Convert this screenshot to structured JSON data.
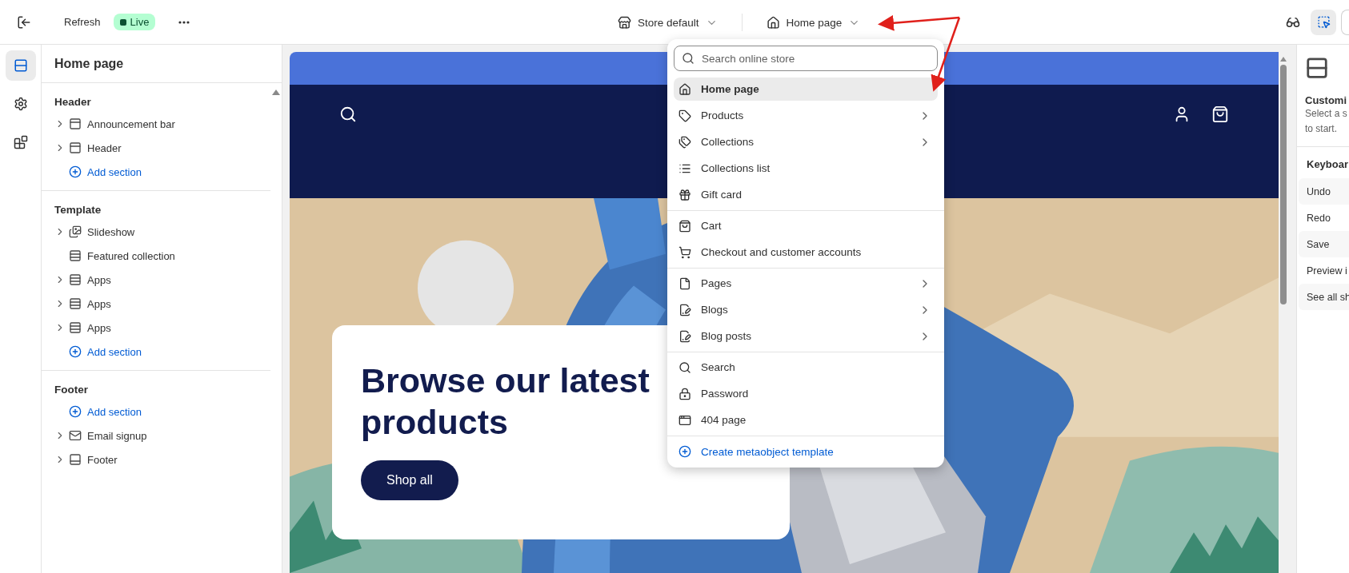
{
  "top_bar": {
    "refresh": "Refresh",
    "status": {
      "label": "Live",
      "live": true
    },
    "theme_selector": {
      "label": "Store default"
    },
    "page_selector": {
      "label": "Home page",
      "expanded": true
    },
    "inspector_selected": true
  },
  "rail": [
    {
      "kind": "sections",
      "selected": true
    },
    {
      "kind": "settings",
      "selected": false
    },
    {
      "kind": "apps",
      "selected": false
    }
  ],
  "sidebar": {
    "title": "Home page",
    "groups": [
      {
        "title": "Header",
        "items": [
          {
            "kind": "bar",
            "label": "Announcement bar",
            "expandable": true
          },
          {
            "kind": "bar",
            "label": "Header",
            "expandable": true
          },
          {
            "kind": "add",
            "label": "Add section",
            "expandable": false
          }
        ]
      },
      {
        "title": "Template",
        "items": [
          {
            "kind": "slideshow",
            "label": "Slideshow",
            "expandable": true
          },
          {
            "kind": "rows",
            "label": "Featured collection",
            "expandable": false
          },
          {
            "kind": "rows",
            "label": "Apps",
            "expandable": true
          },
          {
            "kind": "rows",
            "label": "Apps",
            "expandable": true
          },
          {
            "kind": "rows",
            "label": "Apps",
            "expandable": true
          },
          {
            "kind": "add",
            "label": "Add section",
            "expandable": false
          }
        ]
      },
      {
        "title": "Footer",
        "items": [
          {
            "kind": "add",
            "label": "Add section",
            "expandable": false
          },
          {
            "kind": "mail",
            "label": "Email signup",
            "expandable": true
          },
          {
            "kind": "footer",
            "label": "Footer",
            "expandable": true
          }
        ]
      }
    ]
  },
  "page_menu": {
    "search": {
      "placeholder": "Search online store"
    },
    "groups": [
      [
        {
          "kind": "home",
          "label": "Home page",
          "submenu": false,
          "selected": true
        },
        {
          "kind": "tag",
          "label": "Products",
          "submenu": true,
          "selected": false
        },
        {
          "kind": "tags",
          "label": "Collections",
          "submenu": true,
          "selected": false
        },
        {
          "kind": "taglist",
          "label": "Collections list",
          "submenu": false,
          "selected": false
        },
        {
          "kind": "gift",
          "label": "Gift card",
          "submenu": false,
          "selected": false
        }
      ],
      [
        {
          "kind": "bag",
          "label": "Cart",
          "submenu": false,
          "selected": false
        },
        {
          "kind": "cart",
          "label": "Checkout and customer accounts",
          "submenu": false,
          "selected": false
        }
      ],
      [
        {
          "kind": "page",
          "label": "Pages",
          "submenu": true,
          "selected": false
        },
        {
          "kind": "edit",
          "label": "Blogs",
          "submenu": true,
          "selected": false
        },
        {
          "kind": "edit",
          "label": "Blog posts",
          "submenu": true,
          "selected": false
        }
      ],
      [
        {
          "kind": "search",
          "label": "Search",
          "submenu": false,
          "selected": false
        },
        {
          "kind": "lock",
          "label": "Password",
          "submenu": false,
          "selected": false
        },
        {
          "kind": "layout",
          "label": "404 page",
          "submenu": false,
          "selected": false
        }
      ]
    ],
    "create": "Create metaobject template"
  },
  "preview": {
    "hero": {
      "title": "Browse our latest products",
      "button": "Shop all"
    }
  },
  "right_panel": {
    "title": "Customi",
    "text_lines": [
      "Select a s",
      "to start."
    ],
    "shortcuts_title": "Keyboar",
    "shortcuts": [
      "Undo",
      "Redo",
      "Save",
      "Preview i",
      "See all sh"
    ]
  }
}
